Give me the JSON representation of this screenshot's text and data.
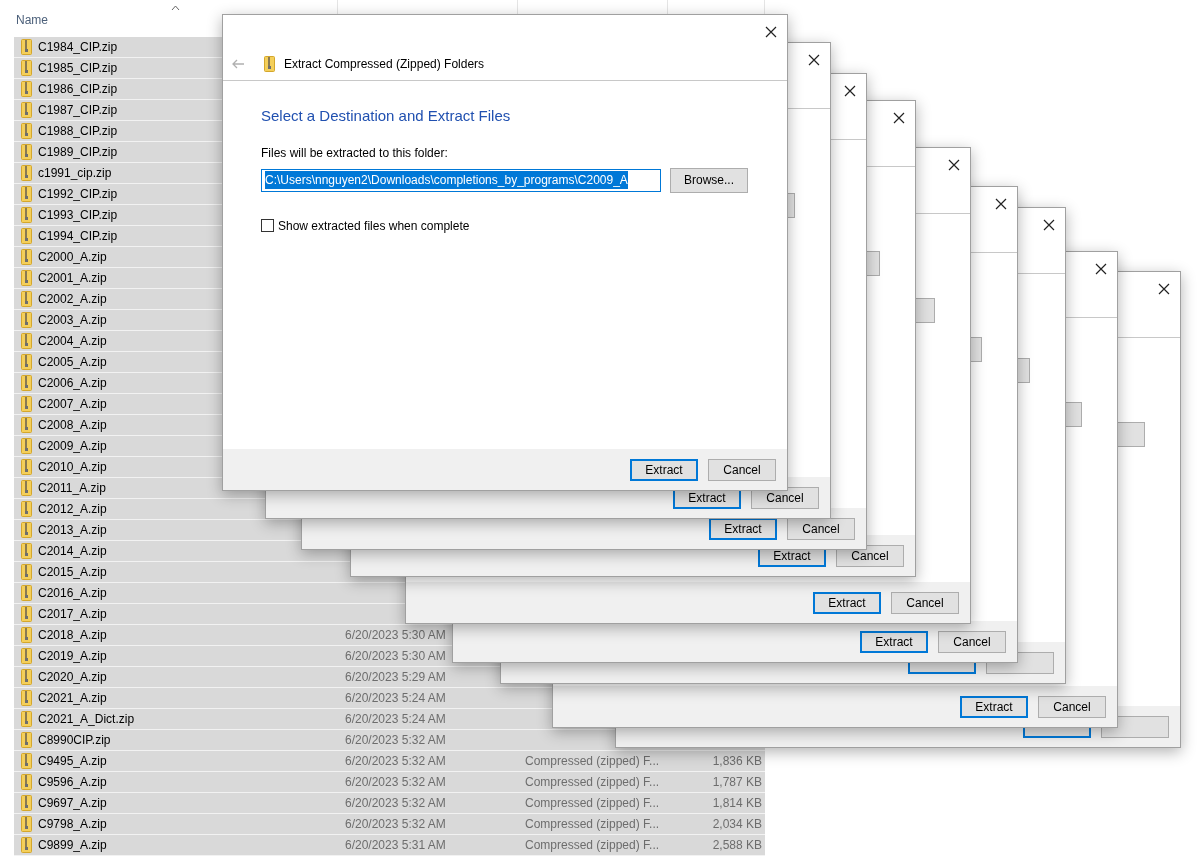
{
  "explorer": {
    "columns": [
      {
        "label": "Name",
        "sorted": true
      }
    ],
    "rows": [
      {
        "name": "C1984_CIP.zip",
        "selected": true
      },
      {
        "name": "C1985_CIP.zip",
        "selected": true
      },
      {
        "name": "C1986_CIP.zip",
        "selected": true
      },
      {
        "name": "C1987_CIP.zip",
        "selected": true
      },
      {
        "name": "C1988_CIP.zip",
        "selected": true
      },
      {
        "name": "C1989_CIP.zip",
        "selected": true
      },
      {
        "name": "c1991_cip.zip",
        "selected": true
      },
      {
        "name": "C1992_CIP.zip",
        "selected": true
      },
      {
        "name": "C1993_CIP.zip",
        "selected": true
      },
      {
        "name": "C1994_CIP.zip",
        "selected": true
      },
      {
        "name": "C2000_A.zip",
        "selected": true
      },
      {
        "name": "C2001_A.zip",
        "selected": true
      },
      {
        "name": "C2002_A.zip",
        "selected": true
      },
      {
        "name": "C2003_A.zip",
        "selected": true
      },
      {
        "name": "C2004_A.zip",
        "selected": true
      },
      {
        "name": "C2005_A.zip",
        "selected": true
      },
      {
        "name": "C2006_A.zip",
        "selected": true
      },
      {
        "name": "C2007_A.zip",
        "selected": true
      },
      {
        "name": "C2008_A.zip",
        "selected": true
      },
      {
        "name": "C2009_A.zip",
        "selected": true
      },
      {
        "name": "C2010_A.zip",
        "selected": true
      },
      {
        "name": "C2011_A.zip",
        "selected": true
      },
      {
        "name": "C2012_A.zip",
        "selected": true
      },
      {
        "name": "C2013_A.zip",
        "selected": true
      },
      {
        "name": "C2014_A.zip",
        "selected": true
      },
      {
        "name": "C2015_A.zip",
        "selected": true
      },
      {
        "name": "C2016_A.zip",
        "selected": true
      },
      {
        "name": "C2017_A.zip",
        "selected": true
      },
      {
        "name": "C2018_A.zip",
        "date": "6/20/2023 5:30 AM",
        "selected": true
      },
      {
        "name": "C2019_A.zip",
        "date": "6/20/2023 5:30 AM",
        "selected": true
      },
      {
        "name": "C2020_A.zip",
        "date": "6/20/2023 5:29 AM",
        "selected": true
      },
      {
        "name": "C2021_A.zip",
        "date": "6/20/2023 5:24 AM",
        "selected": true
      },
      {
        "name": "C2021_A_Dict.zip",
        "date": "6/20/2023 5:24 AM",
        "selected": true
      },
      {
        "name": "C8990CIP.zip",
        "date": "6/20/2023 5:32 AM",
        "selected": true
      },
      {
        "name": "C9495_A.zip",
        "date": "6/20/2023 5:32 AM",
        "type": "Compressed (zipped) F...",
        "size": "1,836 KB",
        "selected": true
      },
      {
        "name": "C9596_A.zip",
        "date": "6/20/2023 5:32 AM",
        "type": "Compressed (zipped) F...",
        "size": "1,787 KB",
        "selected": true
      },
      {
        "name": "C9697_A.zip",
        "date": "6/20/2023 5:32 AM",
        "type": "Compressed (zipped) F...",
        "size": "1,814 KB",
        "selected": true
      },
      {
        "name": "C9798_A.zip",
        "date": "6/20/2023 5:32 AM",
        "type": "Compressed (zipped) F...",
        "size": "2,034 KB",
        "selected": true
      },
      {
        "name": "C9899_A.zip",
        "date": "6/20/2023 5:31 AM",
        "type": "Compressed (zipped) F...",
        "size": "2,588 KB",
        "selected": true
      }
    ]
  },
  "dialogs": [
    {
      "kind": "full",
      "title": "Extract Compressed (Zipped) Folders",
      "heading": "Select a Destination and Extract Files",
      "field_label": "Files will be extracted to this folder:",
      "path": {
        "value": "C:\\Users\\nnguyen2\\Downloads\\completions_by_programs\\C2009_A",
        "highlighted": true
      },
      "browse": "Browse...",
      "checkbox": {
        "label": "Show extracted files when complete",
        "checked": false
      },
      "buttons": [
        "Extract",
        "Cancel"
      ]
    },
    {
      "kind": "stacked",
      "buttons": [
        "Extract",
        "Cancel"
      ]
    },
    {
      "kind": "stacked",
      "buttons": [
        "Extract",
        "Cancel"
      ]
    },
    {
      "kind": "stacked",
      "buttons": [
        "Extract",
        "Cancel"
      ]
    },
    {
      "kind": "stacked",
      "buttons": [
        "Extract",
        "Cancel"
      ]
    },
    {
      "kind": "stacked",
      "buttons": [
        "Extract",
        "Cancel"
      ]
    },
    {
      "kind": "covered"
    },
    {
      "kind": "stacked",
      "buttons": [
        "Extract",
        "Cancel"
      ]
    },
    {
      "kind": "covered"
    }
  ]
}
